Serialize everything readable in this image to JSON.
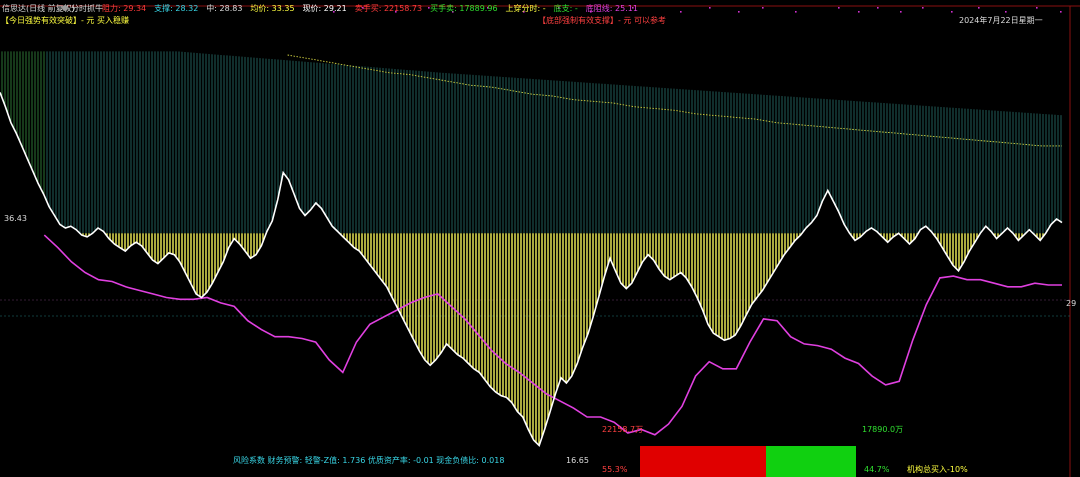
{
  "header": {
    "app_label": "信思达(日线 前复权)",
    "indicator_name": "分时抓牛",
    "fields": [
      {
        "label": "阻力:",
        "value": "29.34",
        "color": "#ff3b3b"
      },
      {
        "label": "支撑:",
        "value": "28.32",
        "color": "#39d6e6"
      },
      {
        "label": "中:",
        "value": "28.83",
        "color": "#dddddd"
      },
      {
        "label": "均价:",
        "value": "33.35",
        "color": "#ffff40"
      },
      {
        "label": "现价:",
        "value": "29.21",
        "color": "#ffffff"
      },
      {
        "label": "卖手买:",
        "value": "22158.73",
        "color": "#ff3b3b"
      },
      {
        "label": "买手卖:",
        "value": "17889.96",
        "color": "#30e030"
      },
      {
        "label": "上穿分时:",
        "value": "-",
        "color": "#ffff40"
      },
      {
        "label": "底支:",
        "value": "-",
        "color": "#30e030"
      },
      {
        "label": "底阻线:",
        "value": "25.11",
        "color": "#e040e0"
      }
    ],
    "line2_left": "【今日强势有效突破】- 元 买入稳赚",
    "line2_center": "【底部强制有效支撑】- 元 可以参考",
    "date": "2024年7月22日星期一"
  },
  "labels": {
    "price_left": "36.43",
    "price_right": "29",
    "low_label": "16.65",
    "sell_value": "22158.7万",
    "buy_value": "17890.0万",
    "sell_pct": "55.3%",
    "buy_pct": "44.7%",
    "institution": "机构总买入-10%",
    "risk": "风险系数  财务预警: 轻警-Z值: 1.736 优质资产率: -0.01 现金负债比: 0.018"
  },
  "colors": {
    "price_line": "#ffffff",
    "avg_line": "#d0d040",
    "lower_band": "#e040e0",
    "yellow_bars": "#f2f25a",
    "teal_bars": "#3aa8a0",
    "green_bars": "#50d060",
    "sell_block": "#e00000",
    "buy_block": "#10d010",
    "dot_magenta": "#d030d0"
  },
  "chart_data": {
    "type": "line",
    "title": "",
    "xlabel": "",
    "ylabel": "",
    "ylim": [
      16.0,
      40.0
    ],
    "price_x_range": [
      0,
      240
    ],
    "price": [
      36.5,
      35.7,
      34.8,
      34.2,
      33.5,
      32.8,
      32.1,
      31.4,
      30.8,
      30.1,
      29.6,
      29.1,
      28.9,
      29.0,
      28.8,
      28.5,
      28.4,
      28.6,
      28.9,
      28.7,
      28.3,
      28.0,
      27.8,
      27.6,
      27.9,
      28.1,
      27.9,
      27.5,
      27.1,
      26.9,
      27.2,
      27.5,
      27.4,
      27.0,
      26.4,
      25.8,
      25.2,
      25.0,
      25.3,
      25.8,
      26.4,
      27.0,
      27.8,
      28.3,
      28.0,
      27.6,
      27.2,
      27.4,
      27.9,
      28.7,
      29.3,
      30.5,
      32.0,
      31.6,
      30.8,
      30.0,
      29.6,
      29.9,
      30.3,
      30.0,
      29.5,
      29.0,
      28.7,
      28.4,
      28.1,
      27.8,
      27.6,
      27.2,
      26.8,
      26.4,
      26.0,
      25.6,
      25.0,
      24.4,
      23.8,
      23.2,
      22.6,
      22.0,
      21.5,
      21.2,
      21.5,
      21.9,
      22.4,
      22.1,
      21.8,
      21.6,
      21.3,
      21.0,
      20.8,
      20.4,
      20.0,
      19.7,
      19.5,
      19.4,
      19.1,
      18.6,
      18.3,
      17.6,
      17.0,
      16.7,
      17.6,
      18.6,
      19.6,
      20.5,
      20.2,
      20.6,
      21.3,
      22.2,
      23.0,
      24.0,
      25.1,
      26.2,
      27.2,
      26.5,
      25.8,
      25.5,
      25.8,
      26.4,
      27.0,
      27.4,
      27.1,
      26.6,
      26.2,
      26.0,
      26.2,
      26.4,
      26.1,
      25.6,
      25.0,
      24.3,
      23.5,
      23.0,
      22.8,
      22.6,
      22.7,
      22.9,
      23.4,
      24.0,
      24.6,
      25.0,
      25.4,
      25.9,
      26.4,
      26.9,
      27.4,
      27.8,
      28.2,
      28.5,
      28.9,
      29.2,
      29.6,
      30.4,
      31.0,
      30.4,
      29.8,
      29.1,
      28.6,
      28.2,
      28.4,
      28.7,
      28.9,
      28.7,
      28.4,
      28.1,
      28.4,
      28.6,
      28.3,
      28.0,
      28.3,
      28.8,
      29.0,
      28.7,
      28.3,
      27.8,
      27.3,
      26.8,
      26.5,
      27.0,
      27.6,
      28.1,
      28.6,
      29.0,
      28.7,
      28.3,
      28.6,
      28.9,
      28.6,
      28.2,
      28.5,
      28.8,
      28.5,
      28.2,
      28.6,
      29.1,
      29.4,
      29.2
    ],
    "avg_x_range": [
      65,
      240
    ],
    "avg": [
      38.6,
      38.4,
      38.2,
      38.0,
      37.8,
      37.6,
      37.5,
      37.3,
      37.1,
      36.9,
      36.8,
      36.6,
      36.4,
      36.3,
      36.1,
      36.0,
      35.9,
      35.7,
      35.6,
      35.5,
      35.3,
      35.2,
      35.1,
      35.0,
      34.8,
      34.7,
      34.6,
      34.5,
      34.4,
      34.3,
      34.2,
      34.1,
      34.0,
      33.9,
      33.8,
      33.7,
      33.6,
      33.5,
      33.5
    ],
    "lower_band_x_range": [
      10,
      240
    ],
    "lower_band": [
      28.5,
      27.8,
      27.0,
      26.4,
      26.0,
      25.9,
      25.6,
      25.4,
      25.2,
      25.0,
      24.9,
      24.9,
      25.0,
      24.7,
      24.5,
      23.7,
      23.2,
      22.8,
      22.8,
      22.7,
      22.5,
      21.5,
      20.8,
      22.5,
      23.5,
      23.9,
      24.3,
      24.7,
      25.0,
      25.2,
      24.5,
      23.8,
      22.9,
      22.0,
      21.3,
      20.8,
      20.2,
      19.6,
      19.2,
      18.8,
      18.3,
      18.3,
      18.0,
      17.4,
      17.6,
      17.3,
      17.9,
      18.9,
      20.6,
      21.4,
      21.0,
      21.0,
      22.5,
      23.8,
      23.7,
      22.8,
      22.4,
      22.3,
      22.1,
      21.6,
      21.3,
      20.6,
      20.1,
      20.3,
      22.6,
      24.6,
      26.1,
      26.2,
      26.0,
      26.0,
      25.8,
      25.6,
      25.6,
      25.8,
      25.7,
      25.7
    ]
  }
}
